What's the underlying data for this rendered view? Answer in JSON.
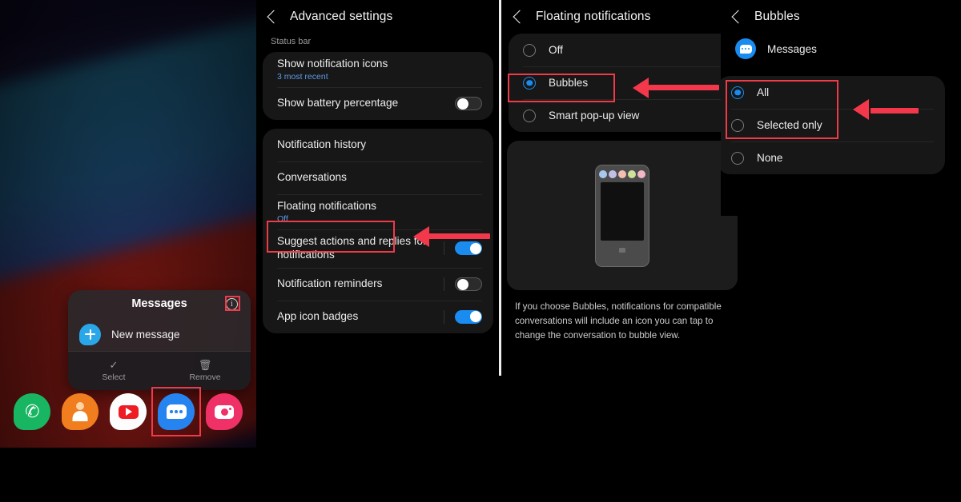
{
  "home": {
    "popup": {
      "title": "Messages",
      "info_icon": "info-icon",
      "shortcut_label": "New message",
      "footer": [
        {
          "label": "Select",
          "glyph": "✓",
          "icon_name": "select-check-icon"
        },
        {
          "label": "Remove",
          "glyph": "🗑",
          "icon_name": "trash-icon"
        }
      ]
    },
    "dock": [
      {
        "name": "phone",
        "label": "Phone",
        "color": "#18b662"
      },
      {
        "name": "contacts",
        "label": "Contacts",
        "color": "#f07d1e"
      },
      {
        "name": "youtube",
        "label": "YouTube",
        "color": "#fdfdfd"
      },
      {
        "name": "messages",
        "label": "Messages",
        "color": "#2684f0"
      },
      {
        "name": "camera",
        "label": "Camera",
        "color": "#ef3168"
      }
    ]
  },
  "advanced": {
    "title": "Advanced settings",
    "section_label": "Status bar",
    "rows": {
      "show_notification_icons": {
        "title": "Show notification icons",
        "sub": "3 most recent"
      },
      "show_battery_percentage": {
        "title": "Show battery percentage",
        "state": "off"
      },
      "notification_history": {
        "title": "Notification history"
      },
      "conversations": {
        "title": "Conversations"
      },
      "floating_notifications": {
        "title": "Floating notifications",
        "sub": "Off"
      },
      "suggest_actions": {
        "title": "Suggest actions and replies for notifications",
        "state": "on"
      },
      "notification_reminders": {
        "title": "Notification reminders",
        "state": "off"
      },
      "app_icon_badges": {
        "title": "App icon badges",
        "state": "on"
      }
    }
  },
  "floating": {
    "title": "Floating notifications",
    "options": [
      {
        "label": "Off",
        "selected": false
      },
      {
        "label": "Bubbles",
        "selected": true
      },
      {
        "label": "Smart pop-up view",
        "selected": false
      }
    ],
    "preview_bubble_colors": [
      "#a8c8ef",
      "#c3c0e8",
      "#f3bfb3",
      "#cfe39a",
      "#f3b8c6"
    ],
    "description": "If you choose Bubbles, notifications for compatible conversations will include an icon you can tap to change the conversation to bubble view."
  },
  "bubbles": {
    "title": "Bubbles",
    "app_name": "Messages",
    "options": [
      {
        "label": "All",
        "selected": true
      },
      {
        "label": "Selected only",
        "selected": false
      },
      {
        "label": "None",
        "selected": false
      }
    ]
  },
  "annotations": {
    "accent_color": "#ef3a47",
    "boxes": [
      "messages-dock-icon",
      "popup-info-icon",
      "floating-notifications-row",
      "bubbles-radio-option",
      "all-and-selected-only-options"
    ],
    "arrows": [
      "arrow-to-floating-notifications",
      "arrow-to-bubbles-option",
      "arrow-to-all-option"
    ],
    "cursors": [
      "cursor-on-info-icon",
      "cursor-on-messages-icon"
    ]
  }
}
